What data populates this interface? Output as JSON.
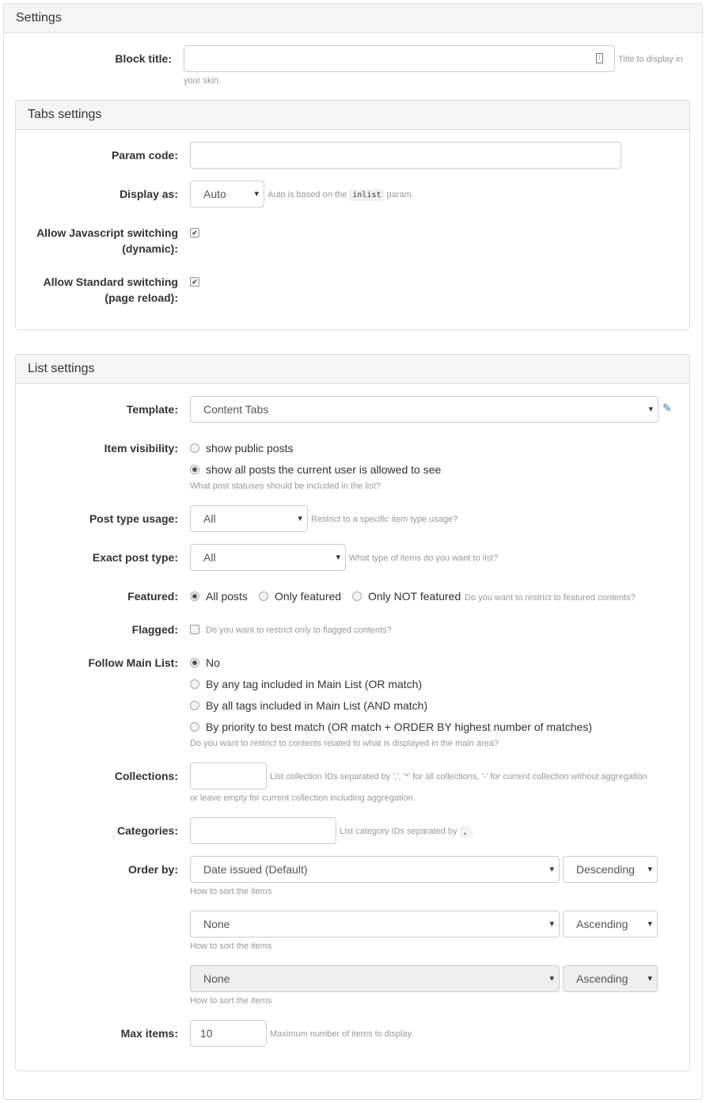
{
  "settings": {
    "title": "Settings",
    "block_title_label": "Block title:",
    "block_title_value": "",
    "block_title_hint_1": "Title to display in",
    "block_title_hint_2": "your skin."
  },
  "tabs": {
    "title": "Tabs settings",
    "param_code_label": "Param code:",
    "param_code_value": "",
    "display_as_label": "Display as:",
    "display_as_value": "Auto",
    "display_as_hint_pre": "Auto is based on the",
    "display_as_hint_code": "inlist",
    "display_as_hint_post": "param.",
    "js_label_1": "Allow Javascript switching",
    "js_label_2": "(dynamic):",
    "js_checked": true,
    "std_label_1": "Allow Standard switching",
    "std_label_2": "(page reload):",
    "std_checked": true
  },
  "list": {
    "title": "List settings",
    "template_label": "Template:",
    "template_value": "Content Tabs",
    "visibility_label": "Item visibility:",
    "visibility_options": [
      "show public posts",
      "show all posts the current user is allowed to see"
    ],
    "visibility_selected": 1,
    "visibility_hint": "What post statuses should be included in the list?",
    "post_type_usage_label": "Post type usage:",
    "post_type_usage_value": "All",
    "post_type_usage_hint": "Restrict to a specific item type usage?",
    "exact_type_label": "Exact post type:",
    "exact_type_value": "All",
    "exact_type_hint": "What type of items do you want to list?",
    "featured_label": "Featured:",
    "featured_options": [
      "All posts",
      "Only featured",
      "Only NOT featured"
    ],
    "featured_selected": 0,
    "featured_hint": "Do you want to restrict to featured contents?",
    "flagged_label": "Flagged:",
    "flagged_checked": false,
    "flagged_hint": "Do you want to restrict only to flagged contents?",
    "follow_label": "Follow Main List:",
    "follow_options": [
      "No",
      "By any tag included in Main List (OR match)",
      "By all tags included in Main List (AND match)",
      "By priority to best match (OR match + ORDER BY highest number of matches)"
    ],
    "follow_selected": 0,
    "follow_hint": "Do you want to restrict to contents related to what is displayed in the main area?",
    "collections_label": "Collections:",
    "collections_value": "",
    "collections_hint_1": "List collection IDs separated by ',', '*' for all collections, '-' for current collection without aggregation",
    "collections_hint_2": "or leave empty for current collection including aggregation.",
    "categories_label": "Categories:",
    "categories_value": "",
    "categories_hint_pre": "List category IDs separated by",
    "categories_hint_code": ",",
    "categories_hint_post": ".",
    "order_label": "Order by:",
    "orders": [
      {
        "field": "Date issued (Default)",
        "dir": "Descending",
        "hint": "How to sort the items"
      },
      {
        "field": "None",
        "dir": "Ascending",
        "hint": "How to sort the items"
      },
      {
        "field": "None",
        "dir": "Ascending",
        "hint": "How to sort the items"
      }
    ],
    "max_items_label": "Max items:",
    "max_items_value": "10",
    "max_items_hint": "Maximum number of items to display."
  }
}
